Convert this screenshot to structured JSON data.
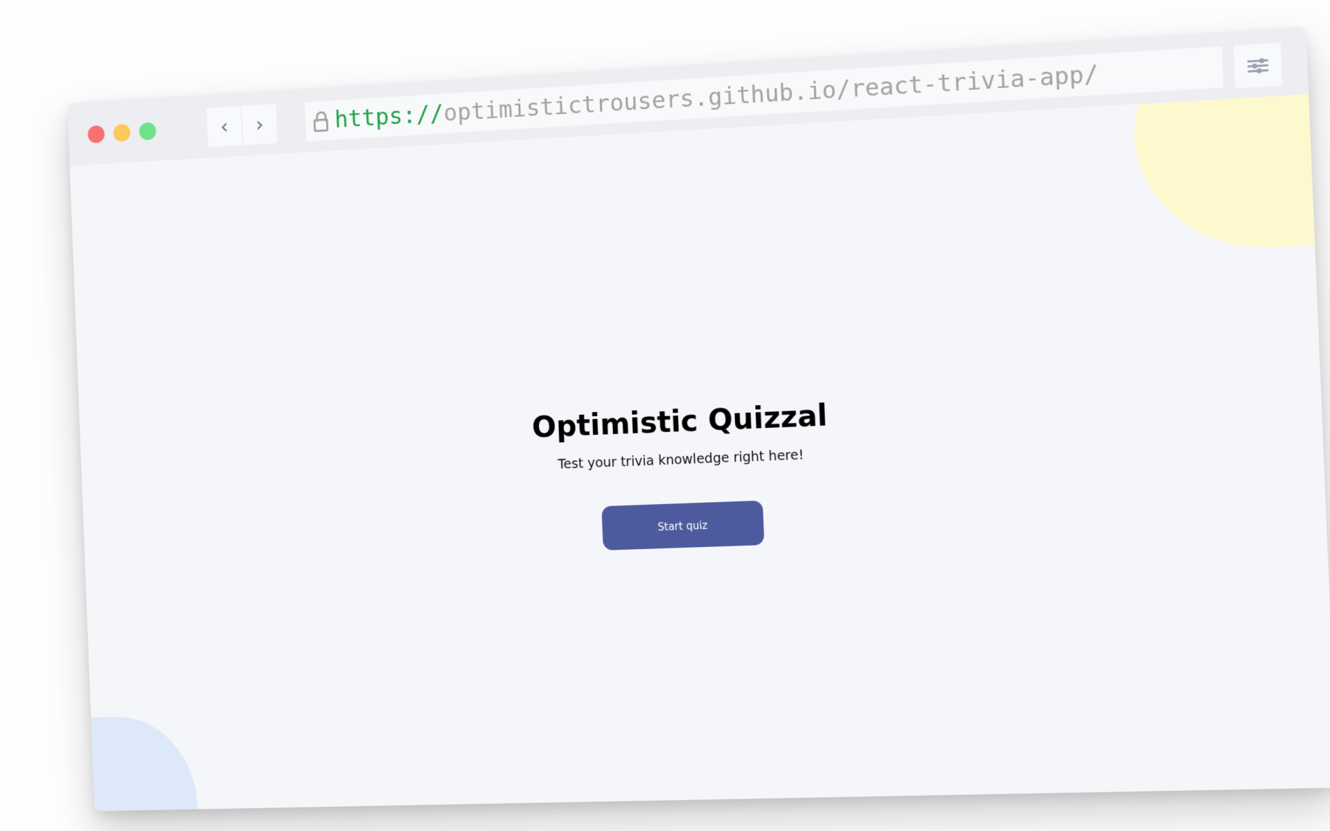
{
  "browser": {
    "back_label": "‹",
    "forward_label": "›",
    "url_scheme": "https://",
    "url_rest": "optimistictrousers.github.io/react-trivia-app/",
    "icons": {
      "lock": "lock-icon",
      "settings": "sliders-icon",
      "back": "chevron-left-icon",
      "forward": "chevron-right-icon"
    },
    "colors": {
      "close": "#f87171",
      "minimize": "#fcc75d",
      "maximize": "#6ee28a",
      "scheme": "#21a34a"
    }
  },
  "page": {
    "title": "Optimistic Quizzal",
    "subtitle": "Test your trivia knowledge right here!",
    "start_button_label": "Start quiz",
    "colors": {
      "button": "#4d5b9e",
      "background": "#f5f6f9",
      "blob_yellow": "#fef8cf",
      "blob_blue": "#dde8f8"
    }
  }
}
